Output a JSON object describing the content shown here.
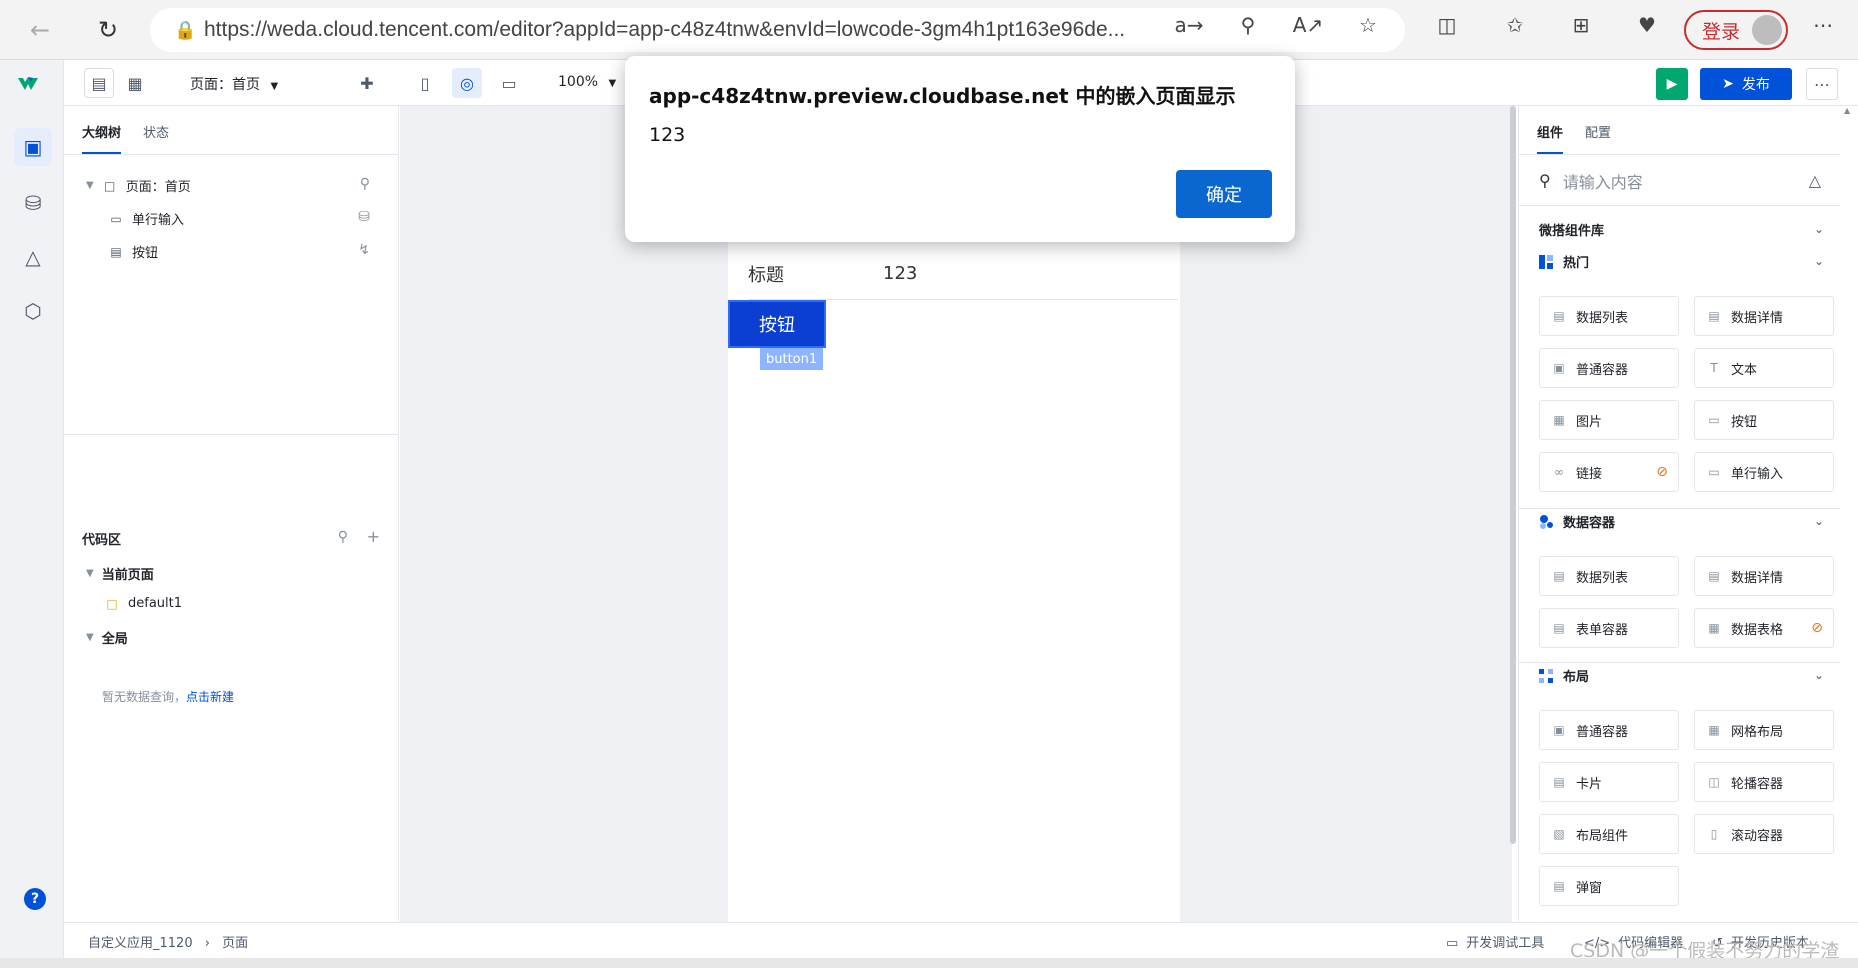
{
  "browser": {
    "url": "https://weda.cloud.tencent.com/editor?appId=app-c48z4tnw&envId=lowcode-3gm4h1pt163e96de...",
    "login_label": "登录"
  },
  "toolbar": {
    "page_selector": "页面：首页",
    "zoom": "100%",
    "publish_label": "发布"
  },
  "left_panel": {
    "tabs": [
      "大纲树",
      "状态"
    ],
    "tree": {
      "page": "页面：首页",
      "children": [
        "单行输入",
        "按钮"
      ]
    },
    "code_area": {
      "title": "代码区",
      "current_page": "当前页面",
      "current_file": "default1",
      "global": "全局",
      "empty_hint": "暂无数据查询，",
      "create_link": "点击新建"
    }
  },
  "canvas": {
    "form_label": "标题",
    "form_value": "123",
    "button_label": "按钮",
    "component_tag": "button1"
  },
  "right_panel": {
    "tabs": [
      "组件",
      "配置"
    ],
    "search_placeholder": "请输入内容",
    "library_title": "微搭组件库",
    "sections": [
      {
        "title": "热门",
        "items": [
          "数据列表",
          "数据详情",
          "普通容器",
          "文本",
          "图片",
          "按钮",
          "链接",
          "单行输入"
        ]
      },
      {
        "title": "数据容器",
        "items": [
          "数据列表",
          "数据详情",
          "表单容器",
          "数据表格"
        ]
      },
      {
        "title": "布局",
        "items": [
          "普通容器",
          "网格布局",
          "卡片",
          "轮播容器",
          "布局组件",
          "滚动容器",
          "弹窗"
        ]
      }
    ]
  },
  "status_bar": {
    "app_name": "自定义应用_1120",
    "page": "页面",
    "tools": [
      "开发调试工具",
      "代码编辑器",
      "开发历史版本"
    ],
    "watermark": "CSDN @一个假装不努力的学渣"
  },
  "dialog": {
    "title": "app-c48z4tnw.preview.cloudbase.net 中的嵌入页面显示",
    "message": "123",
    "ok_label": "确定"
  }
}
